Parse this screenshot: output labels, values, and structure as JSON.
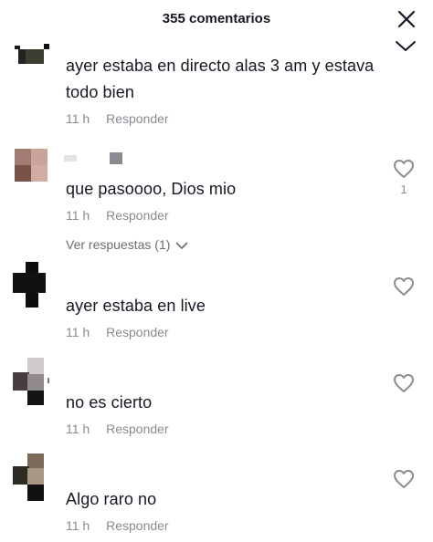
{
  "header": {
    "title": "355 comentarios",
    "close_icon": "close-icon"
  },
  "comments": [
    {
      "text": "ayer estaba en directo alas 3 am y estava todo bien",
      "time": "11 h",
      "reply_label": "Responder",
      "likes": ""
    },
    {
      "text": "que pasoooo, Dios mio",
      "time": "11 h",
      "reply_label": "Responder",
      "likes": "1",
      "view_replies": "Ver respuestas (1)"
    },
    {
      "text": "ayer estaba en live",
      "time": "11 h",
      "reply_label": "Responder",
      "likes": ""
    },
    {
      "text": "no es cierto",
      "time": "11 h",
      "reply_label": "Responder",
      "likes": ""
    },
    {
      "text": "Algo raro no",
      "time": "11 h",
      "reply_label": "Responder",
      "likes": ""
    }
  ]
}
